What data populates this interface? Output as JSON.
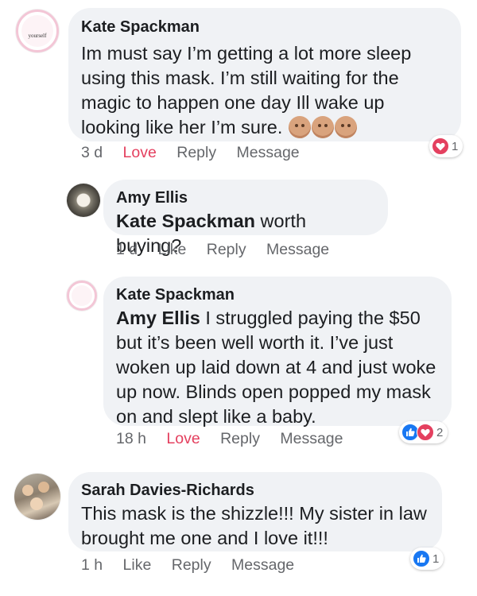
{
  "comments": [
    {
      "author": "Kate Spackman",
      "mention": "",
      "text": "Im must say I’m getting a lot more sleep using this mask. I’m still waiting for the magic to happen one day Ill wake up looking like her I’m sure.",
      "time": "3 d",
      "like_label": "Love",
      "reply_label": "Reply",
      "message_label": "Message",
      "reaction_count": "1",
      "avatar_text": "yourself"
    },
    {
      "author": "Amy Ellis",
      "mention": "Kate Spackman",
      "text": " worth buying?",
      "time": "1 d",
      "like_label": "Like",
      "reply_label": "Reply",
      "message_label": "Message"
    },
    {
      "author": "Kate Spackman",
      "mention": "Amy Ellis",
      "text": " I struggled paying the $50 but it’s been well worth it. I’ve just woken up laid down at 4 and just woke up now. Blinds open popped my mask on and slept like a baby.",
      "time": "18 h",
      "like_label": "Love",
      "reply_label": "Reply",
      "message_label": "Message",
      "reaction_count": "2"
    },
    {
      "author": "Sarah Davies-Richards",
      "mention": "",
      "text": "This mask is the shizzle!!! My sister in law brought me one and I love it!!!",
      "time": "1 h",
      "like_label": "Like",
      "reply_label": "Reply",
      "message_label": "Message",
      "reaction_count": "1"
    }
  ],
  "colors": {
    "bubble": "#f0f2f5",
    "love": "#e4405f",
    "like_icon": "#1877f2",
    "muted": "#65676b"
  }
}
